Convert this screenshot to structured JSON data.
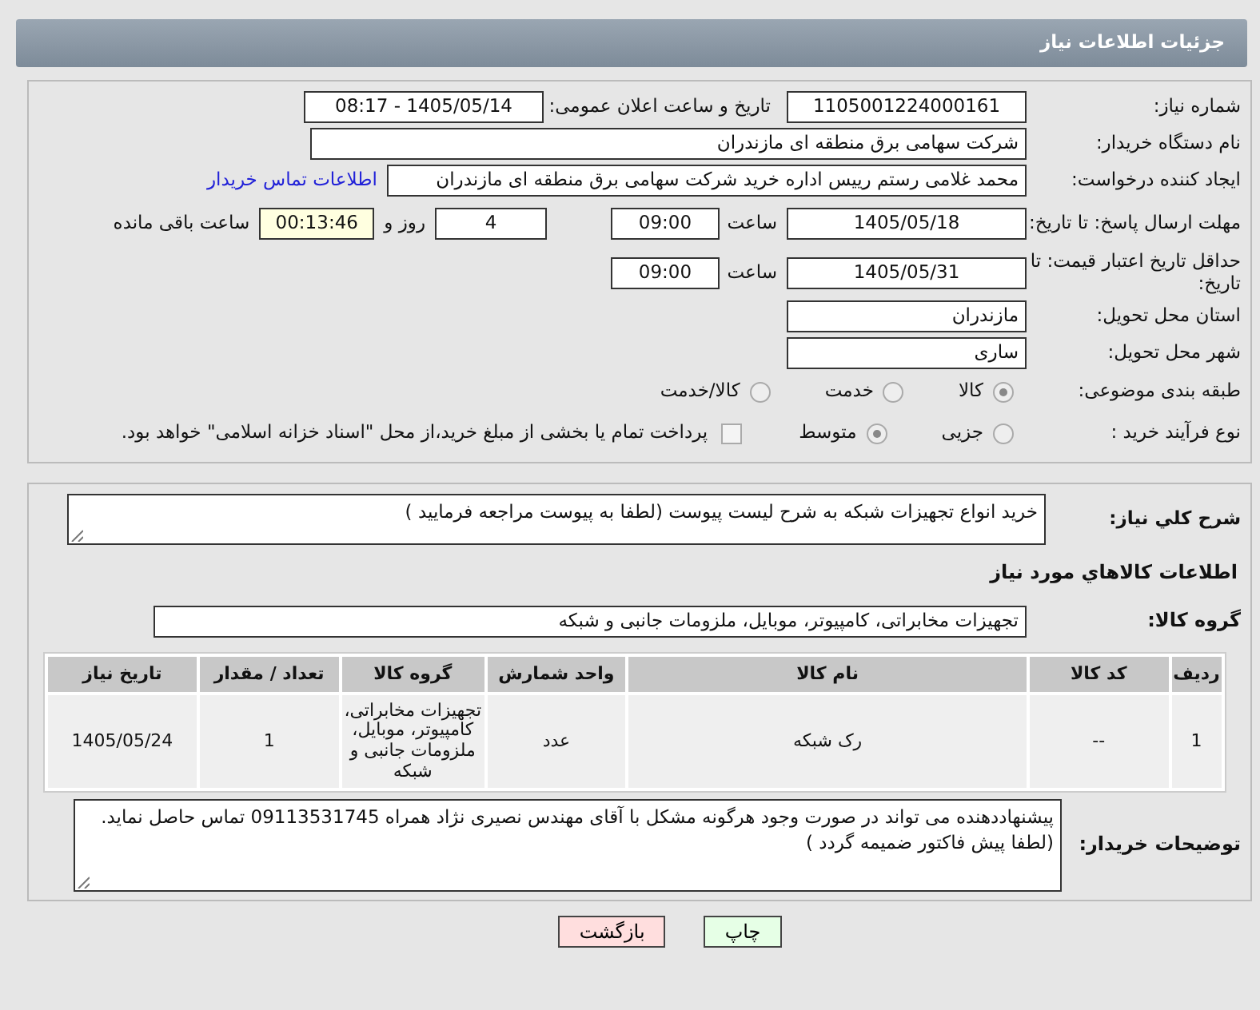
{
  "header": {
    "title": "جزئیات اطلاعات نیاز"
  },
  "need_number": {
    "label": "شماره نیاز:",
    "value": "1105001224000161"
  },
  "announce": {
    "label": "تاریخ و ساعت اعلان عمومی:",
    "value": "1405/05/14 - 08:17"
  },
  "buyer": {
    "label": "نام دستگاه خریدار:",
    "value": "شرکت سهامی برق منطقه ای مازندران"
  },
  "creator": {
    "label": "ایجاد کننده درخواست:",
    "value": "محمد غلامی رستم رییس اداره خرید شرکت سهامی برق منطقه ای مازندران",
    "link": "اطلاعات تماس خریدار"
  },
  "deadline": {
    "label": "مهلت ارسال پاسخ: تا تاریخ:",
    "date": "1405/05/18",
    "time_label": "ساعت",
    "time": "09:00",
    "days": "4",
    "days_label": "روز و",
    "remaining": "00:13:46",
    "remaining_label": "ساعت باقی مانده"
  },
  "validity": {
    "label": "حداقل تاریخ اعتبار قیمت: تا تاریخ:",
    "date": "1405/05/31",
    "time_label": "ساعت",
    "time": "09:00"
  },
  "province": {
    "label": "استان محل تحویل:",
    "value": "مازندران"
  },
  "city": {
    "label": "شهر محل تحویل:",
    "value": "ساری"
  },
  "category": {
    "label": "طبقه بندی موضوعی:",
    "options": [
      {
        "label": "کالا",
        "selected": true
      },
      {
        "label": "خدمت",
        "selected": false
      },
      {
        "label": "کالا/خدمت",
        "selected": false
      }
    ]
  },
  "process": {
    "label": "نوع فرآیند خرید :",
    "options": [
      {
        "label": "جزیی",
        "selected": false
      },
      {
        "label": "متوسط",
        "selected": true
      }
    ],
    "payment": {
      "label": "پرداخت تمام یا بخشی از مبلغ خرید،از محل \"اسناد خزانه اسلامی\" خواهد بود.",
      "checked": false
    }
  },
  "description": {
    "label": "شرح کلي نياز:",
    "value": "خرید انواع تجهیزات شبکه به شرح لیست پیوست (لطفا به پیوست مراجعه فرمایید )"
  },
  "goods_heading": "اطلاعات کالاهاي مورد نياز",
  "goods_group": {
    "label": "گروه کالا:",
    "value": "تجهیزات مخابراتی، کامپیوتر، موبایل، ملزومات جانبی و شبکه"
  },
  "table": {
    "columns": [
      "ردیف",
      "کد کالا",
      "نام کالا",
      "واحد شمارش",
      "گروه کالا",
      "تعداد / مقدار",
      "تاریخ نیاز"
    ],
    "rows": [
      [
        "1",
        "--",
        "رک شبکه",
        "عدد",
        "تجهیزات مخابراتی، کامپیوتر، موبایل، ملزومات جانبی و شبکه",
        "1",
        "1405/05/24"
      ]
    ]
  },
  "buyer_notes": {
    "label": "توضیحات خریدار:",
    "lines": [
      "پیشنهاددهنده می تواند در صورت وجود هرگونه مشکل با آقای مهندس نصیری نژاد همراه 09113531745 تماس حاصل نماید.",
      "(لطفا پیش فاکتور ضمیمه گردد )"
    ]
  },
  "buttons": [
    {
      "label": "چاپ",
      "kind": "print"
    },
    {
      "label": "بازگشت",
      "kind": "back"
    }
  ]
}
